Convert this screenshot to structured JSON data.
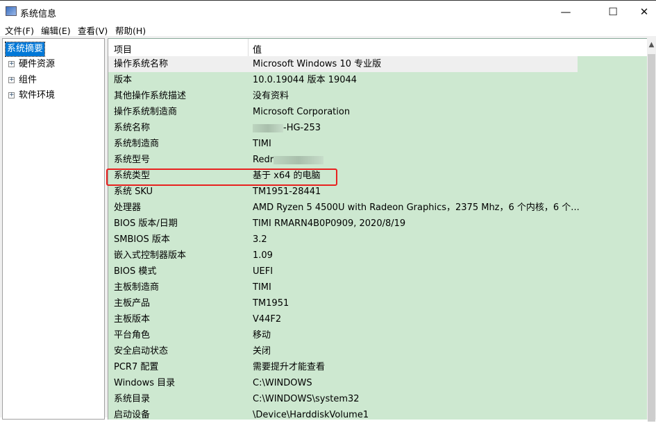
{
  "window": {
    "title": "系统信息",
    "minimize": "—",
    "maximize": "☐",
    "close": "✕"
  },
  "menu": [
    "文件(F)",
    "编辑(E)",
    "查看(V)",
    "帮助(H)"
  ],
  "tree": {
    "selected": "系统摘要",
    "items": [
      "硬件资源",
      "组件",
      "软件环境"
    ]
  },
  "list": {
    "headers": [
      "项目",
      "值"
    ],
    "rows": [
      [
        "操作系统名称",
        "Microsoft Windows 10 专业版"
      ],
      [
        "版本",
        "10.0.19044 版本 19044"
      ],
      [
        "其他操作系统描述",
        "没有资料"
      ],
      [
        "操作系统制造商",
        "Microsoft Corporation"
      ],
      [
        "系统名称",
        "-HG-253"
      ],
      [
        "系统制造商",
        "TIMI"
      ],
      [
        "系统型号",
        "Redr"
      ],
      [
        "系统类型",
        "基于 x64 的电脑"
      ],
      [
        "系统 SKU",
        "TM1951-28441"
      ],
      [
        "处理器",
        "AMD Ryzen 5 4500U with Radeon Graphics，2375 Mhz，6 个内核，6 个..."
      ],
      [
        "BIOS 版本/日期",
        "TIMI RMARN4B0P0909, 2020/8/19"
      ],
      [
        "SMBIOS 版本",
        "3.2"
      ],
      [
        "嵌入式控制器版本",
        "1.09"
      ],
      [
        "BIOS 模式",
        "UEFI"
      ],
      [
        "主板制造商",
        "TIMI"
      ],
      [
        "主板产品",
        "TM1951"
      ],
      [
        "主板版本",
        "V44F2"
      ],
      [
        "平台角色",
        "移动"
      ],
      [
        "安全启动状态",
        "关闭"
      ],
      [
        "PCR7 配置",
        "需要提升才能查看"
      ],
      [
        "Windows 目录",
        "C:\\WINDOWS"
      ],
      [
        "系统目录",
        "C:\\WINDOWS\\system32"
      ],
      [
        "启动设备",
        "\\Device\\HarddiskVolume1"
      ]
    ]
  },
  "colors": {
    "row_bg": "#cde8d0",
    "selection": "#0078d7",
    "highlight_box": "#e8211f"
  }
}
